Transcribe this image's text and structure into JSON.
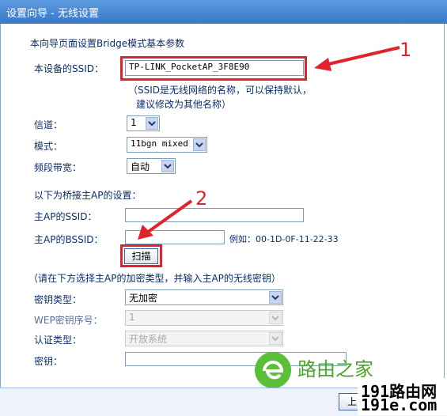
{
  "window": {
    "title": "设置向导 - 无线设置"
  },
  "intro": "本向导页面设置Bridge模式基本参数",
  "ssid": {
    "label": "本设备的SSID：",
    "value": "TP-LINK_PocketAP_3F8E90",
    "note_line1": "（SSID是无线网络的名称，可以保持默认，",
    "note_line2": "建议修改为其他名称）"
  },
  "channel": {
    "label": "信道：",
    "value": "1"
  },
  "mode": {
    "label": "模式：",
    "value": "11bgn mixed"
  },
  "bandwidth": {
    "label": "频段带宽：",
    "value": "自动"
  },
  "bridge_section": "以下为桥接主AP的设置：",
  "main_ap_ssid": {
    "label": "主AP的SSID：",
    "value": ""
  },
  "main_ap_bssid": {
    "label": "主AP的BSSID：",
    "value": "",
    "example": "例如：00-1D-0F-11-22-33"
  },
  "scan_button": "扫描",
  "encrypt_note": "（请在下方选择主AP的加密类型，并输入主AP的无线密钥）",
  "key_type": {
    "label": "密钥类型：",
    "value": "无加密"
  },
  "wep_index": {
    "label": "WEP密钥序号：",
    "value": "1"
  },
  "auth_type": {
    "label": "认证类型：",
    "value": "开放系统"
  },
  "key": {
    "label": "密钥：",
    "value": ""
  },
  "annotations": {
    "one": "1",
    "two": "2"
  },
  "watermark": {
    "text1": "路由之家",
    "text2": "191路由网",
    "text3": "191e.com"
  },
  "bottom_button": "上",
  "colors": {
    "accent_red": "#e0232c",
    "title_blue": "#3a78c9",
    "label_blue": "#0b2d6b"
  }
}
